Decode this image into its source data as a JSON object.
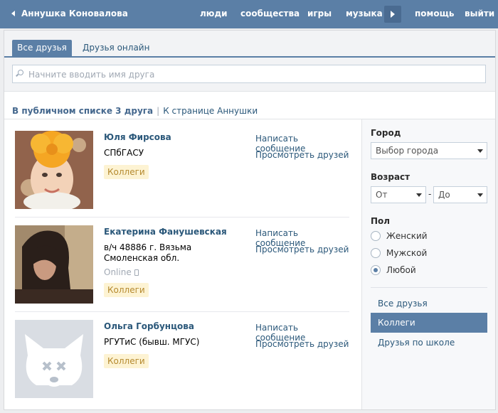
{
  "header": {
    "back_label": "Аннушка Коновалова",
    "nav": [
      "люди",
      "сообщества",
      "игры",
      "музыка",
      "помощь",
      "выйти"
    ]
  },
  "tabs": {
    "all": "Все друзья",
    "online": "Друзья онлайн"
  },
  "search": {
    "placeholder": "Начните вводить имя друга"
  },
  "summary": {
    "count_text": "В публичном списке 3 друга",
    "separator": "|",
    "link": "К странице Аннушки"
  },
  "friends": [
    {
      "name": "Юля Фирсова",
      "info": "СПбГАСУ",
      "online": "",
      "tag": "Коллеги",
      "actions": [
        "Написать сообщение",
        "Просмотреть друзей"
      ]
    },
    {
      "name": "Екатерина Фанушевская",
      "info": "в/ч 48886 г. Вязьма Смоленская обл.",
      "online": "Online",
      "tag": "Коллеги",
      "actions": [
        "Написать сообщение",
        "Просмотреть друзей"
      ]
    },
    {
      "name": "Ольга Горбунцова",
      "info": "РГУТиС (бывш. МГУС)",
      "online": "",
      "tag": "Коллеги",
      "actions": [
        "Написать сообщение",
        "Просмотреть друзей"
      ]
    }
  ],
  "filters": {
    "city": {
      "label": "Город",
      "value": "Выбор города"
    },
    "age": {
      "label": "Возраст",
      "from": "От",
      "dash": "-",
      "to": "До"
    },
    "sex": {
      "label": "Пол",
      "options": [
        "Женский",
        "Мужской",
        "Любой"
      ],
      "selected": "Любой"
    },
    "lists": [
      "Все друзья",
      "Коллеги",
      "Друзья по школе"
    ],
    "active_list": "Коллеги"
  },
  "colors": {
    "header": "#5b7fa6",
    "link": "#2b587a",
    "tag_bg": "#fdf3d3"
  }
}
